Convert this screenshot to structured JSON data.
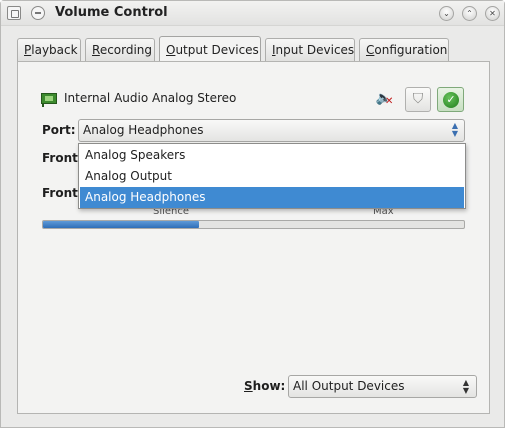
{
  "window": {
    "title": "Volume Control",
    "buttons": {
      "minimize": "⌄",
      "maximize": "⌃",
      "close": "✕"
    }
  },
  "tabs": [
    {
      "first": "P",
      "rest": "layback"
    },
    {
      "first": "R",
      "rest": "ecording"
    },
    {
      "first": "O",
      "rest": "utput Devices"
    },
    {
      "first": "I",
      "rest": "nput Devices"
    },
    {
      "first": "C",
      "rest": "onfiguration"
    }
  ],
  "active_tab_index": 2,
  "device": {
    "icon": "sound-card-icon",
    "name": "Internal Audio Analog Stereo",
    "mute_icon": "speaker-muted-icon",
    "lock_icon": "shield-icon",
    "default_icon": "check-circle-icon"
  },
  "port": {
    "label": "Port:",
    "selected": "Analog Headphones",
    "options": [
      "Analog Speakers",
      "Analog Output",
      "Analog Headphones"
    ],
    "highlighted_index": 2
  },
  "channels": {
    "front_label_1": "Front",
    "front_label_2": "Front",
    "scale_silence": "Silence",
    "scale_max": "Max"
  },
  "meter": {
    "level_fraction": 0.37
  },
  "show": {
    "label_first": "S",
    "label_rest": "how:",
    "selected": "All Output Devices"
  },
  "colors": {
    "accent": "#3f8ad2",
    "meter": "#2f6eb8",
    "check": "#1f7d1d",
    "mute_x": "#c01a1a"
  }
}
